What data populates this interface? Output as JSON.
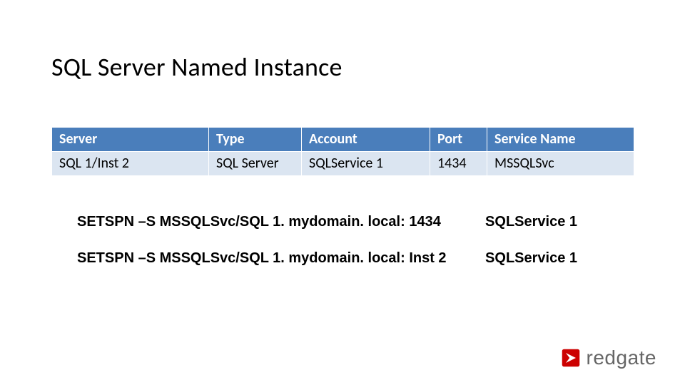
{
  "title": "SQL Server Named Instance",
  "table": {
    "headers": [
      "Server",
      "Type",
      "Account",
      "Port",
      "Service Name"
    ],
    "row": [
      "SQL 1/Inst 2",
      "SQL Server",
      "SQLService 1",
      "1434",
      "MSSQLSvc"
    ]
  },
  "commands": [
    {
      "cmd": "SETSPN –S   MSSQLSvc/SQL 1. mydomain. local: 1434",
      "acct": "SQLService 1"
    },
    {
      "cmd": "SETSPN –S  MSSQLSvc/SQL 1. mydomain. local: Inst 2",
      "acct": "SQLService 1"
    }
  ],
  "brand": "redgate"
}
